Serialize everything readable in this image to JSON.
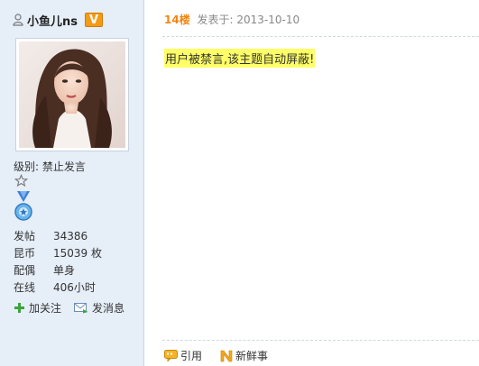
{
  "user": {
    "name": "小鱼儿ns",
    "badge": "V",
    "level_label": "级别: 禁止发言",
    "stats": [
      {
        "label": "发帖",
        "value": "34386"
      },
      {
        "label": "昆币",
        "value": "15039 枚"
      },
      {
        "label": "配偶",
        "value": "单身"
      },
      {
        "label": "在线",
        "value": "406小时"
      }
    ],
    "actions": {
      "follow": "加关注",
      "message": "发消息"
    }
  },
  "post": {
    "floor": "14楼",
    "posted_at": "发表于: 2013-10-10",
    "notice": "用户被禁言,该主题自动屏蔽!",
    "footer": {
      "quote": "引用",
      "fresh": "新鲜事"
    }
  },
  "colors": {
    "sidebar_bg": "#e6eef8",
    "floor": "#f2850e",
    "highlight": "#ffff66",
    "badge": "#f49a14"
  },
  "icons": [
    "user-icon",
    "vip-badge",
    "star-icon",
    "medal-icon",
    "plus-icon",
    "mail-icon",
    "quote-icon",
    "fresh-icon"
  ]
}
